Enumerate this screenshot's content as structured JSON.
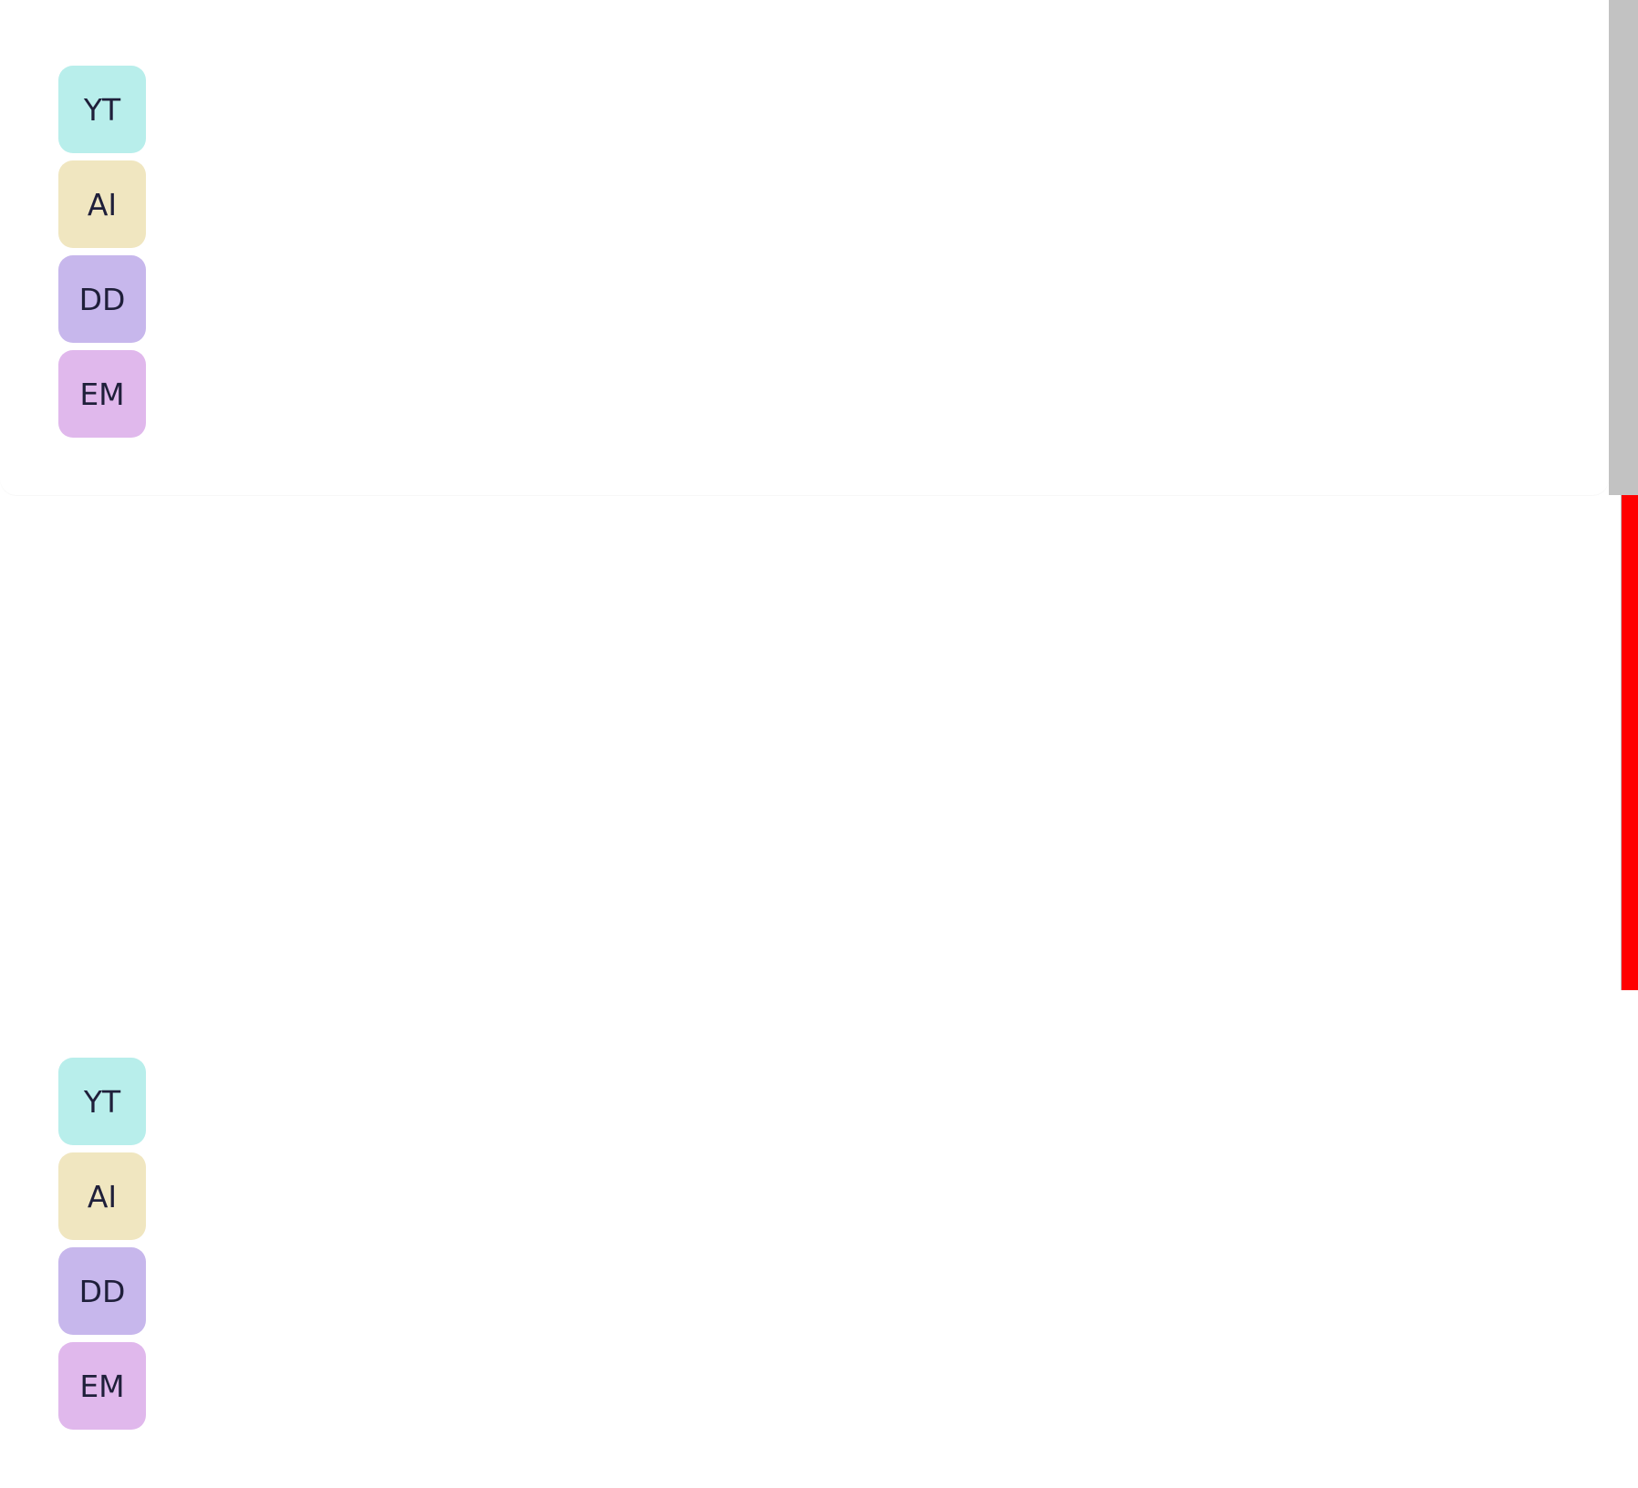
{
  "colors": {
    "avatar_yt": "#b8eeeb",
    "avatar_ai": "#f0e6c0",
    "avatar_dd": "#c7b7ec",
    "avatar_em": "#e0b8ec",
    "scrollbar_track": "#c2c2c2",
    "scrollbar_thumb": "#ff0000"
  },
  "panels": [
    {
      "avatars": [
        {
          "initials": "YT"
        },
        {
          "initials": "AI"
        },
        {
          "initials": "DD"
        },
        {
          "initials": "EM"
        }
      ]
    },
    {
      "avatars": [
        {
          "initials": "YT"
        },
        {
          "initials": "AI"
        },
        {
          "initials": "DD"
        },
        {
          "initials": "EM"
        }
      ]
    }
  ]
}
